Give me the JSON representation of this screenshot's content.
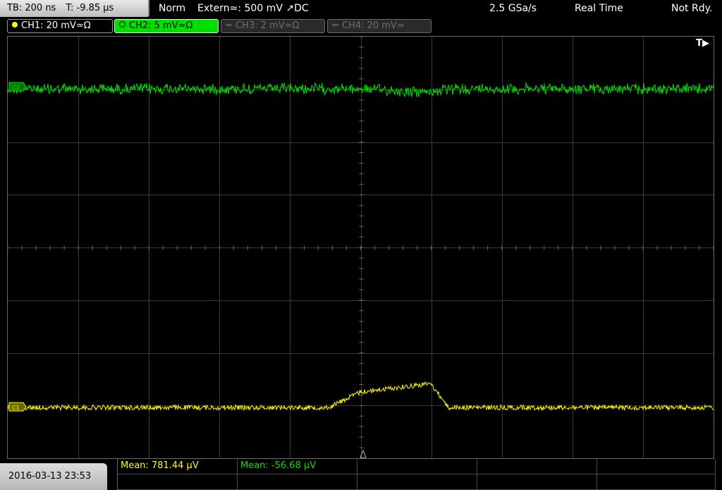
{
  "topbar": {
    "timebase": "TB: 200 ns",
    "trigger_time": "T: -9.85 µs",
    "mode": "Norm",
    "trigger_source": "Extern≃: 500 mV ↗DC",
    "sample_rate": "2.5 GSa/s",
    "acquisition": "Real Time",
    "status": "Not Rdy."
  },
  "channels": [
    {
      "label": "CH1: 20 mV≃Ω",
      "state": "active",
      "color": "#ffff00"
    },
    {
      "label": "CH2: 5 mV≃Ω",
      "state": "selected",
      "color": "#00e000"
    },
    {
      "label": "CH3: 2 mV≃Ω",
      "state": "off",
      "color": "#6f6f6f"
    },
    {
      "label": "CH4: 20 mV≃",
      "state": "off",
      "color": "#6f6f6f"
    }
  ],
  "screen": {
    "trigger_marker": "T▶",
    "ch2_marker": "C2",
    "ch1_marker": "C1",
    "trace_colors": {
      "ch1": "#ffff00",
      "ch2": "#00e000",
      "grid": "#3a3a3a"
    }
  },
  "footer": {
    "datetime": "2016-03-13 23:53",
    "measurements": [
      {
        "text": "Mean: 781.44 µV",
        "color": "yellow"
      },
      {
        "text": "Mean: -56.68 µV",
        "color": "green"
      }
    ]
  }
}
